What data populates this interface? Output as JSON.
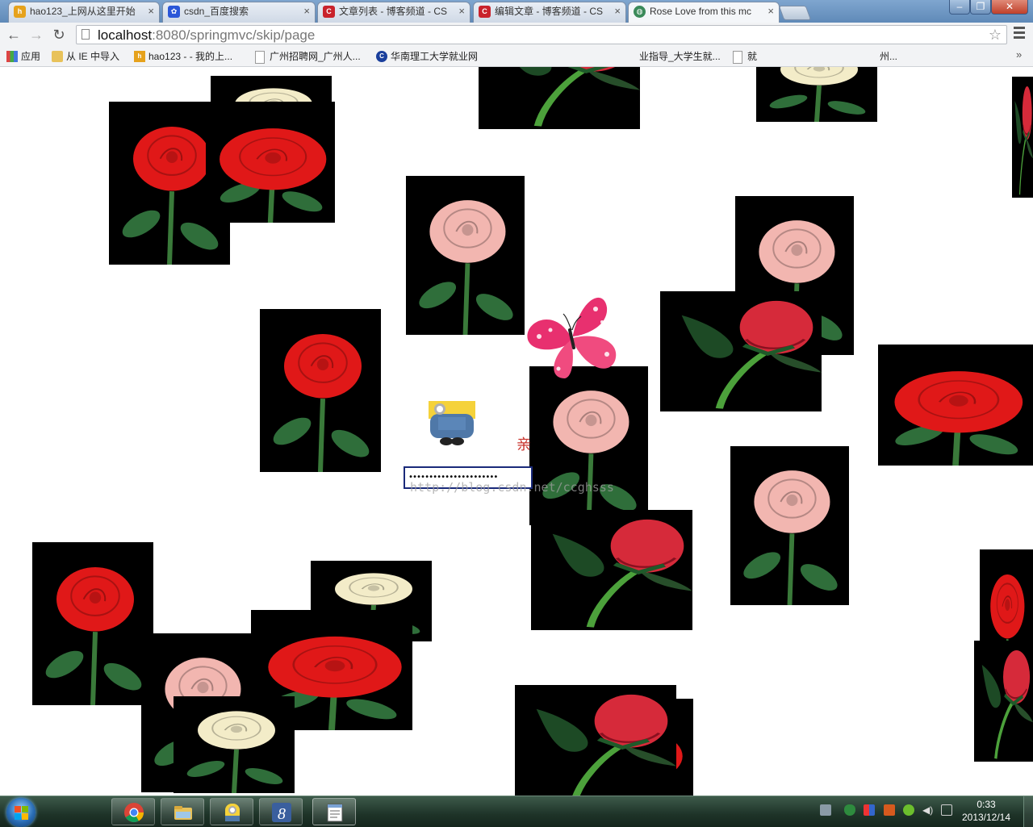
{
  "tabs": [
    {
      "title": "hao123_上网从这里开始",
      "favicon": "hao123-icon",
      "active": false
    },
    {
      "title": "csdn_百度搜索",
      "favicon": "baidu-paw-icon",
      "active": false
    },
    {
      "title": "文章列表 - 博客频道 - CS",
      "favicon": "csdn-c-icon",
      "active": false
    },
    {
      "title": "编辑文章 - 博客频道 - CS",
      "favicon": "csdn-c-icon",
      "active": false
    },
    {
      "title": "Rose Love from this mc",
      "favicon": "chrome-globe-icon",
      "active": true
    }
  ],
  "toolbar": {
    "url_host": "localhost",
    "url_rest": ":8080/springmvc/skip/page"
  },
  "bookmarks": [
    {
      "label": "应用",
      "icon": "apps-grid-icon"
    },
    {
      "label": "从 IE 中导入",
      "icon": "folder-icon"
    },
    {
      "label": "hao123 - - 我的上...",
      "icon": "hao123-icon"
    },
    {
      "label": "广州招聘网_广州人...",
      "icon": "page-icon"
    },
    {
      "label": "华南理工大学就业网",
      "icon": "scut-icon"
    },
    {
      "label": "业指导_大学生就...",
      "icon": "page-icon"
    },
    {
      "label": "就",
      "icon": "page-icon"
    },
    {
      "label": "州...",
      "icon": "page-icon"
    }
  ],
  "page": {
    "love_char": "亲",
    "password_dots": "••••••••••••••••••••••",
    "watermark": "http://blog.csdn.net/ccghsss"
  },
  "roses_note": "decorative falling rose images",
  "taskbar": {
    "apps": [
      "chrome-icon",
      "explorer-folder-icon",
      "minion-icon",
      "eclipse-8-icon",
      "notepad-icon"
    ],
    "clock_time": "0:33",
    "clock_date": "2013/12/14"
  },
  "colors": {
    "rose_red": "#e01818",
    "rose_bud": "#d62a3a",
    "rose_pink": "#f2b6b0",
    "rose_cream": "#f3ecc8",
    "stem_green": "#2f6e3a",
    "love_char": "#c8312a"
  }
}
